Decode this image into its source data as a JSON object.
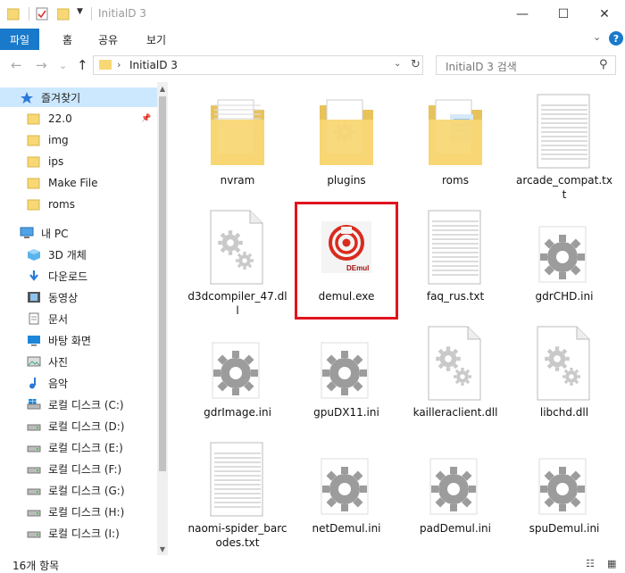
{
  "window": {
    "title": "InitialD 3",
    "controls": {
      "minimize": "—",
      "maximize": "☐",
      "close": "✕"
    }
  },
  "quick_access_icons": [
    "folder-icon",
    "checklist-icon",
    "folder-icon",
    "customize-dropdown-icon"
  ],
  "ribbon": {
    "tabs": [
      "파일",
      "홈",
      "공유",
      "보기"
    ],
    "expand": "⌄",
    "help": "?"
  },
  "navigation": {
    "back": "←",
    "forward": "→",
    "recent": "⌄",
    "up": "↑",
    "address_separator": "›",
    "path": "InitialD 3",
    "search_placeholder": "InitialD 3 검색"
  },
  "sidebar": {
    "items": [
      {
        "label": "즐겨찾기",
        "icon": "star-icon",
        "level": 0,
        "selected": true
      },
      {
        "label": "22.0",
        "icon": "folder-icon",
        "level": 1,
        "pinned": true
      },
      {
        "label": "img",
        "icon": "folder-icon",
        "level": 1
      },
      {
        "label": "ips",
        "icon": "folder-icon",
        "level": 1
      },
      {
        "label": "Make File",
        "icon": "folder-icon",
        "level": 1
      },
      {
        "label": "roms",
        "icon": "folder-icon",
        "level": 1
      },
      {
        "label": "내 PC",
        "icon": "computer-icon",
        "level": 0
      },
      {
        "label": "3D 개체",
        "icon": "cube-icon",
        "level": 1
      },
      {
        "label": "다운로드",
        "icon": "download-icon",
        "level": 1
      },
      {
        "label": "동영상",
        "icon": "video-icon",
        "level": 1
      },
      {
        "label": "문서",
        "icon": "document-icon",
        "level": 1
      },
      {
        "label": "바탕 화면",
        "icon": "desktop-icon",
        "level": 1
      },
      {
        "label": "사진",
        "icon": "pictures-icon",
        "level": 1
      },
      {
        "label": "음악",
        "icon": "music-icon",
        "level": 1
      },
      {
        "label": "로컬 디스크 (C:)",
        "icon": "windows-drive-icon",
        "level": 1
      },
      {
        "label": "로컬 디스크 (D:)",
        "icon": "drive-icon",
        "level": 1
      },
      {
        "label": "로컬 디스크 (E:)",
        "icon": "drive-icon",
        "level": 1
      },
      {
        "label": "로컬 디스크 (F:)",
        "icon": "drive-icon",
        "level": 1
      },
      {
        "label": "로컬 디스크 (G:)",
        "icon": "drive-icon",
        "level": 1
      },
      {
        "label": "로컬 디스크 (H:)",
        "icon": "drive-icon",
        "level": 1
      },
      {
        "label": "로컬 디스크 (I:)",
        "icon": "drive-icon",
        "level": 1
      }
    ]
  },
  "files": [
    {
      "name": "nvram",
      "type": "folder-docs"
    },
    {
      "name": "plugins",
      "type": "folder-gear"
    },
    {
      "name": "roms",
      "type": "folder-files"
    },
    {
      "name": "arcade_compat.txt",
      "type": "text"
    },
    {
      "name": "d3dcompiler_47.dll",
      "type": "dll"
    },
    {
      "name": "demul.exe",
      "type": "exe",
      "highlighted": true,
      "icon_label": "DEmul"
    },
    {
      "name": "faq_rus.txt",
      "type": "text"
    },
    {
      "name": "gdrCHD.ini",
      "type": "ini"
    },
    {
      "name": "gdrImage.ini",
      "type": "ini"
    },
    {
      "name": "gpuDX11.ini",
      "type": "ini"
    },
    {
      "name": "kailleraclient.dll",
      "type": "dll"
    },
    {
      "name": "libchd.dll",
      "type": "dll"
    },
    {
      "name": "naomi-spider_barcodes.txt",
      "type": "text"
    },
    {
      "name": "netDemul.ini",
      "type": "ini"
    },
    {
      "name": "padDemul.ini",
      "type": "ini"
    },
    {
      "name": "spuDemul.ini",
      "type": "ini"
    }
  ],
  "status": {
    "item_count": "16개 항목"
  },
  "colors": {
    "accent": "#1979ca",
    "selection": "#cce8ff",
    "highlight_border": "#e0141e",
    "folder": "#f8d775"
  }
}
